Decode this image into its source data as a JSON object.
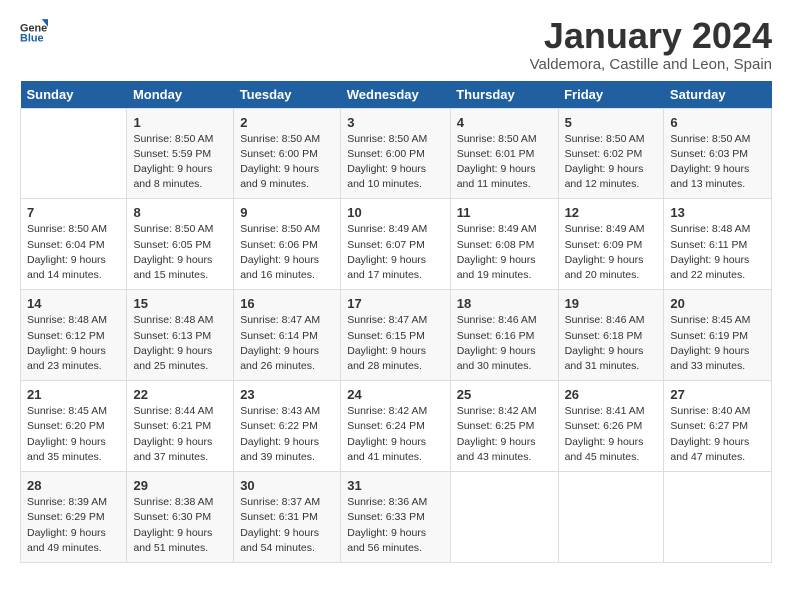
{
  "header": {
    "logo_general": "General",
    "logo_blue": "Blue",
    "title": "January 2024",
    "subtitle": "Valdemora, Castille and Leon, Spain"
  },
  "calendar": {
    "days_of_week": [
      "Sunday",
      "Monday",
      "Tuesday",
      "Wednesday",
      "Thursday",
      "Friday",
      "Saturday"
    ],
    "weeks": [
      [
        {
          "day": "",
          "sunrise": "",
          "sunset": "",
          "daylight": ""
        },
        {
          "day": "1",
          "sunrise": "Sunrise: 8:50 AM",
          "sunset": "Sunset: 5:59 PM",
          "daylight": "Daylight: 9 hours and 8 minutes."
        },
        {
          "day": "2",
          "sunrise": "Sunrise: 8:50 AM",
          "sunset": "Sunset: 6:00 PM",
          "daylight": "Daylight: 9 hours and 9 minutes."
        },
        {
          "day": "3",
          "sunrise": "Sunrise: 8:50 AM",
          "sunset": "Sunset: 6:00 PM",
          "daylight": "Daylight: 9 hours and 10 minutes."
        },
        {
          "day": "4",
          "sunrise": "Sunrise: 8:50 AM",
          "sunset": "Sunset: 6:01 PM",
          "daylight": "Daylight: 9 hours and 11 minutes."
        },
        {
          "day": "5",
          "sunrise": "Sunrise: 8:50 AM",
          "sunset": "Sunset: 6:02 PM",
          "daylight": "Daylight: 9 hours and 12 minutes."
        },
        {
          "day": "6",
          "sunrise": "Sunrise: 8:50 AM",
          "sunset": "Sunset: 6:03 PM",
          "daylight": "Daylight: 9 hours and 13 minutes."
        }
      ],
      [
        {
          "day": "7",
          "sunrise": "Sunrise: 8:50 AM",
          "sunset": "Sunset: 6:04 PM",
          "daylight": "Daylight: 9 hours and 14 minutes."
        },
        {
          "day": "8",
          "sunrise": "Sunrise: 8:50 AM",
          "sunset": "Sunset: 6:05 PM",
          "daylight": "Daylight: 9 hours and 15 minutes."
        },
        {
          "day": "9",
          "sunrise": "Sunrise: 8:50 AM",
          "sunset": "Sunset: 6:06 PM",
          "daylight": "Daylight: 9 hours and 16 minutes."
        },
        {
          "day": "10",
          "sunrise": "Sunrise: 8:49 AM",
          "sunset": "Sunset: 6:07 PM",
          "daylight": "Daylight: 9 hours and 17 minutes."
        },
        {
          "day": "11",
          "sunrise": "Sunrise: 8:49 AM",
          "sunset": "Sunset: 6:08 PM",
          "daylight": "Daylight: 9 hours and 19 minutes."
        },
        {
          "day": "12",
          "sunrise": "Sunrise: 8:49 AM",
          "sunset": "Sunset: 6:09 PM",
          "daylight": "Daylight: 9 hours and 20 minutes."
        },
        {
          "day": "13",
          "sunrise": "Sunrise: 8:48 AM",
          "sunset": "Sunset: 6:11 PM",
          "daylight": "Daylight: 9 hours and 22 minutes."
        }
      ],
      [
        {
          "day": "14",
          "sunrise": "Sunrise: 8:48 AM",
          "sunset": "Sunset: 6:12 PM",
          "daylight": "Daylight: 9 hours and 23 minutes."
        },
        {
          "day": "15",
          "sunrise": "Sunrise: 8:48 AM",
          "sunset": "Sunset: 6:13 PM",
          "daylight": "Daylight: 9 hours and 25 minutes."
        },
        {
          "day": "16",
          "sunrise": "Sunrise: 8:47 AM",
          "sunset": "Sunset: 6:14 PM",
          "daylight": "Daylight: 9 hours and 26 minutes."
        },
        {
          "day": "17",
          "sunrise": "Sunrise: 8:47 AM",
          "sunset": "Sunset: 6:15 PM",
          "daylight": "Daylight: 9 hours and 28 minutes."
        },
        {
          "day": "18",
          "sunrise": "Sunrise: 8:46 AM",
          "sunset": "Sunset: 6:16 PM",
          "daylight": "Daylight: 9 hours and 30 minutes."
        },
        {
          "day": "19",
          "sunrise": "Sunrise: 8:46 AM",
          "sunset": "Sunset: 6:18 PM",
          "daylight": "Daylight: 9 hours and 31 minutes."
        },
        {
          "day": "20",
          "sunrise": "Sunrise: 8:45 AM",
          "sunset": "Sunset: 6:19 PM",
          "daylight": "Daylight: 9 hours and 33 minutes."
        }
      ],
      [
        {
          "day": "21",
          "sunrise": "Sunrise: 8:45 AM",
          "sunset": "Sunset: 6:20 PM",
          "daylight": "Daylight: 9 hours and 35 minutes."
        },
        {
          "day": "22",
          "sunrise": "Sunrise: 8:44 AM",
          "sunset": "Sunset: 6:21 PM",
          "daylight": "Daylight: 9 hours and 37 minutes."
        },
        {
          "day": "23",
          "sunrise": "Sunrise: 8:43 AM",
          "sunset": "Sunset: 6:22 PM",
          "daylight": "Daylight: 9 hours and 39 minutes."
        },
        {
          "day": "24",
          "sunrise": "Sunrise: 8:42 AM",
          "sunset": "Sunset: 6:24 PM",
          "daylight": "Daylight: 9 hours and 41 minutes."
        },
        {
          "day": "25",
          "sunrise": "Sunrise: 8:42 AM",
          "sunset": "Sunset: 6:25 PM",
          "daylight": "Daylight: 9 hours and 43 minutes."
        },
        {
          "day": "26",
          "sunrise": "Sunrise: 8:41 AM",
          "sunset": "Sunset: 6:26 PM",
          "daylight": "Daylight: 9 hours and 45 minutes."
        },
        {
          "day": "27",
          "sunrise": "Sunrise: 8:40 AM",
          "sunset": "Sunset: 6:27 PM",
          "daylight": "Daylight: 9 hours and 47 minutes."
        }
      ],
      [
        {
          "day": "28",
          "sunrise": "Sunrise: 8:39 AM",
          "sunset": "Sunset: 6:29 PM",
          "daylight": "Daylight: 9 hours and 49 minutes."
        },
        {
          "day": "29",
          "sunrise": "Sunrise: 8:38 AM",
          "sunset": "Sunset: 6:30 PM",
          "daylight": "Daylight: 9 hours and 51 minutes."
        },
        {
          "day": "30",
          "sunrise": "Sunrise: 8:37 AM",
          "sunset": "Sunset: 6:31 PM",
          "daylight": "Daylight: 9 hours and 54 minutes."
        },
        {
          "day": "31",
          "sunrise": "Sunrise: 8:36 AM",
          "sunset": "Sunset: 6:33 PM",
          "daylight": "Daylight: 9 hours and 56 minutes."
        },
        {
          "day": "",
          "sunrise": "",
          "sunset": "",
          "daylight": ""
        },
        {
          "day": "",
          "sunrise": "",
          "sunset": "",
          "daylight": ""
        },
        {
          "day": "",
          "sunrise": "",
          "sunset": "",
          "daylight": ""
        }
      ]
    ]
  }
}
